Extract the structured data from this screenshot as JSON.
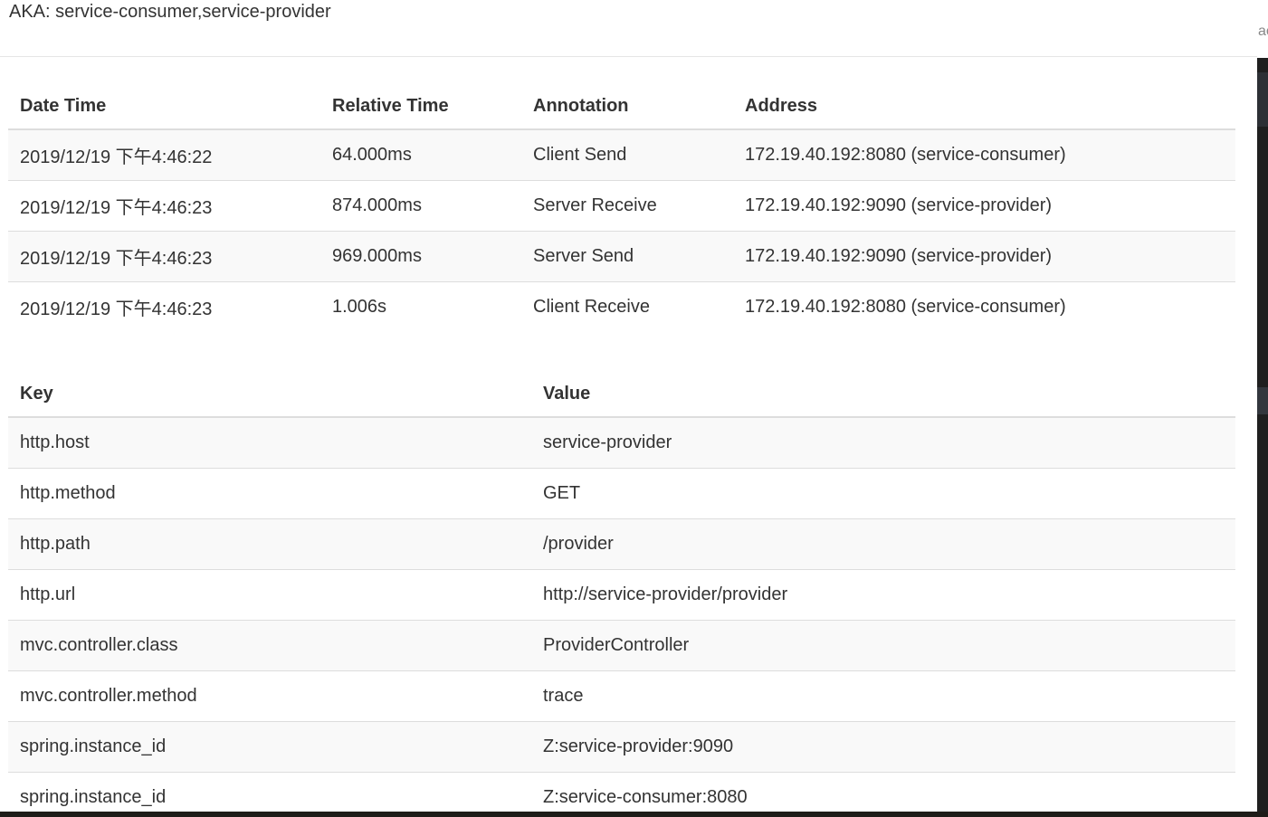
{
  "header": {
    "aka": "AKA: service-consumer,service-provider"
  },
  "scrollbar_peek": "ac",
  "annotations": {
    "columns": [
      "Date Time",
      "Relative Time",
      "Annotation",
      "Address"
    ],
    "rows": [
      [
        "2019/12/19 下午4:46:22",
        "64.000ms",
        "Client Send",
        "172.19.40.192:8080 (service-consumer)"
      ],
      [
        "2019/12/19 下午4:46:23",
        "874.000ms",
        "Server Receive",
        "172.19.40.192:9090 (service-provider)"
      ],
      [
        "2019/12/19 下午4:46:23",
        "969.000ms",
        "Server Send",
        "172.19.40.192:9090 (service-provider)"
      ],
      [
        "2019/12/19 下午4:46:23",
        "1.006s",
        "Client Receive",
        "172.19.40.192:8080 (service-consumer)"
      ]
    ]
  },
  "tags": {
    "columns": [
      "Key",
      "Value"
    ],
    "rows": [
      [
        "http.host",
        "service-provider"
      ],
      [
        "http.method",
        "GET"
      ],
      [
        "http.path",
        "/provider"
      ],
      [
        "http.url",
        "http://service-provider/provider"
      ],
      [
        "mvc.controller.class",
        "ProviderController"
      ],
      [
        "mvc.controller.method",
        "trace"
      ],
      [
        "spring.instance_id",
        "Z:service-provider:9090"
      ],
      [
        "spring.instance_id",
        "Z:service-consumer:8080"
      ]
    ]
  }
}
